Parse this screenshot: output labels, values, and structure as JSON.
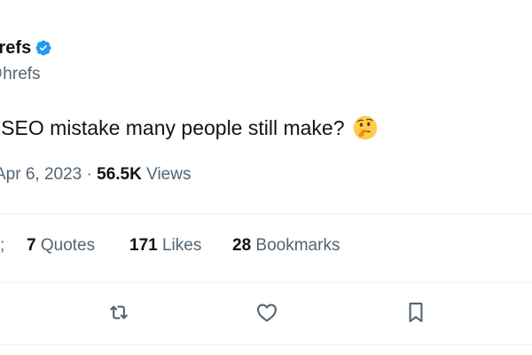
{
  "author": {
    "display_name": "hrefs",
    "handle": "hrefs",
    "verified_icon": "verified-badge-icon",
    "verified_color": "#1d9bf0"
  },
  "tweet": {
    "text": "e SEO mistake many people still make?",
    "emoji": "thinking-face-emoji"
  },
  "meta": {
    "date": "Apr 6, 2023",
    "separator": "·",
    "views_count": "56.5K",
    "views_label": "Views"
  },
  "stats": {
    "stub_text": ";",
    "quotes_count": "7",
    "quotes_label": "Quotes",
    "likes_count": "171",
    "likes_label": "Likes",
    "bookmarks_count": "28",
    "bookmarks_label": "Bookmarks"
  },
  "actions": [
    {
      "name": "retweet",
      "icon": "retweet-icon"
    },
    {
      "name": "like",
      "icon": "heart-icon"
    },
    {
      "name": "bookmark",
      "icon": "bookmark-icon"
    }
  ],
  "colors": {
    "text_primary": "#0f1419",
    "text_secondary": "#536471",
    "divider": "#eff3f4",
    "icon": "#536471"
  }
}
